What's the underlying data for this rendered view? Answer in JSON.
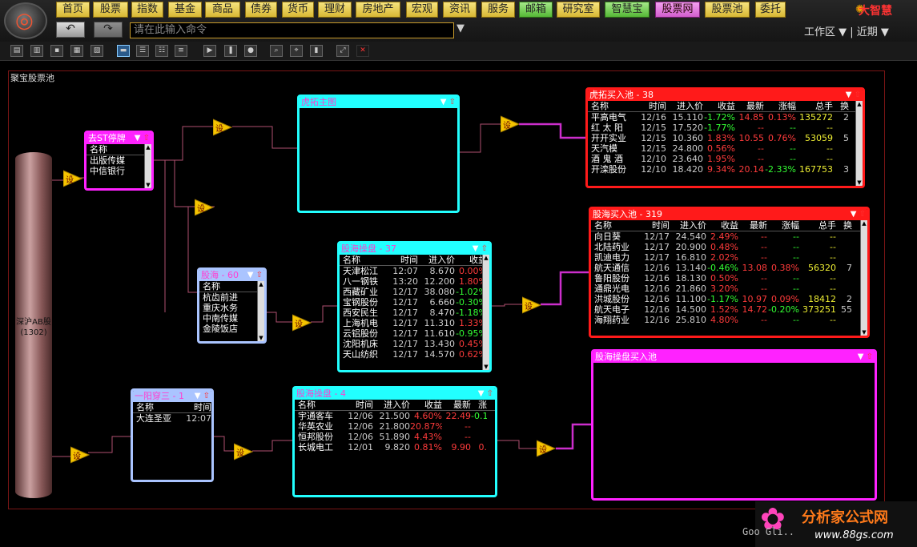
{
  "menu": [
    "首页",
    "股票",
    "指数",
    "基金",
    "商品",
    "债券",
    "货币",
    "理财",
    "房地产",
    "宏观",
    "资讯",
    "服务",
    "邮箱",
    "研究室",
    "智慧宝",
    "股票网",
    "股票池",
    "委托"
  ],
  "brand": "大智慧",
  "command": {
    "placeholder": "请在此输入命令"
  },
  "workzone": "工作区 ▼ | 近期 ▼",
  "board_title": "聚宝股票池",
  "source": {
    "label": "深沪AB股",
    "count": "(1302)"
  },
  "node_label": "设",
  "panels": {
    "quchu": {
      "title": "去ST停牌",
      "head": [
        "名称"
      ],
      "rows": [
        [
          "出版传媒"
        ],
        [
          "中信银行"
        ]
      ]
    },
    "hutuo_zhutu": {
      "title": "虎拓主图"
    },
    "guhai60": {
      "title": "股海 - 60",
      "head": [
        "名称"
      ],
      "rows": [
        [
          "杭齿前进"
        ],
        [
          "重庆水务"
        ],
        [
          "中南传媒"
        ],
        [
          "金陵饭店"
        ]
      ]
    },
    "guhai_caopan": {
      "title": "股海操盘 - 37",
      "head": [
        "名称",
        "时间",
        "进入价",
        "收益"
      ],
      "rows": [
        [
          "天津松江",
          "12:07",
          "8.670",
          "0.00%"
        ],
        [
          "八一钢铁",
          "13:20",
          "12.200",
          "1.80%"
        ],
        [
          "西藏矿业",
          "12/17",
          "38.080",
          "-1.02%"
        ],
        [
          "宝钢股份",
          "12/17",
          "6.660",
          "-0.30%"
        ],
        [
          "西安民生",
          "12/17",
          "8.470",
          "-1.18%"
        ],
        [
          "上海机电",
          "12/17",
          "11.310",
          "1.33%"
        ],
        [
          "云铝股份",
          "12/17",
          "11.610",
          "-0.95%"
        ],
        [
          "沈阳机床",
          "12/17",
          "13.430",
          "0.45%"
        ],
        [
          "天山纺织",
          "12/17",
          "14.570",
          "0.62%"
        ]
      ]
    },
    "yiyang": {
      "title": "一阳穿三 - 1",
      "head": [
        "名称",
        "时间"
      ],
      "rows": [
        [
          "大连圣亚",
          "12:07"
        ]
      ]
    },
    "guhai_caopan4": {
      "title": "股海操盘 - 4",
      "head": [
        "名称",
        "时间",
        "进入价",
        "收益",
        "最新",
        "涨"
      ],
      "rows": [
        [
          "宇通客车",
          "12/06",
          "21.500",
          "4.60%",
          "22.49",
          "-0.1"
        ],
        [
          "华英农业",
          "12/06",
          "21.800",
          "20.87%",
          "--",
          ""
        ],
        [
          "恒邦股份",
          "12/06",
          "51.890",
          "4.43%",
          "--",
          ""
        ],
        [
          "长城电工",
          "12/01",
          "9.820",
          "0.81%",
          "9.90",
          "0."
        ]
      ]
    },
    "hutuo_buy": {
      "title": "虎拓买入池 - 38",
      "head": [
        "名称",
        "时间",
        "进入价",
        "收益",
        "最新",
        "涨幅",
        "总手",
        "换"
      ],
      "rows": [
        [
          "平高电气",
          "12/16",
          "15.110",
          "-1.72%",
          "14.85",
          "0.13%",
          "135272",
          "2"
        ],
        [
          "红 太 阳",
          "12/15",
          "17.520",
          "-1.77%",
          "--",
          "--",
          "--",
          ""
        ],
        [
          "开开实业",
          "12/15",
          "10.360",
          "1.83%",
          "10.55",
          "0.76%",
          "53059",
          "5"
        ],
        [
          "天汽模",
          "12/15",
          "24.800",
          "0.56%",
          "--",
          "--",
          "--",
          ""
        ],
        [
          "酒 鬼 酒",
          "12/10",
          "23.640",
          "1.95%",
          "--",
          "--",
          "--",
          ""
        ],
        [
          "开滦股份",
          "12/10",
          "18.420",
          "9.34%",
          "20.14",
          "-2.33%",
          "167753",
          "3"
        ]
      ]
    },
    "guhai_buy": {
      "title": "股海买入池 - 319",
      "head": [
        "名称",
        "时间",
        "进入价",
        "收益",
        "最新",
        "涨幅",
        "总手",
        "换"
      ],
      "rows": [
        [
          "向日葵",
          "12/17",
          "24.540",
          "2.49%",
          "--",
          "--",
          "--",
          ""
        ],
        [
          "北陆药业",
          "12/17",
          "20.900",
          "0.48%",
          "--",
          "--",
          "--",
          ""
        ],
        [
          "凯迪电力",
          "12/17",
          "16.810",
          "2.02%",
          "--",
          "--",
          "--",
          ""
        ],
        [
          "航天通信",
          "12/16",
          "13.140",
          "-0.46%",
          "13.08",
          "0.38%",
          "56320",
          "7"
        ],
        [
          "鲁阳股份",
          "12/16",
          "18.130",
          "0.50%",
          "--",
          "--",
          "--",
          ""
        ],
        [
          "通鼎光电",
          "12/16",
          "21.860",
          "3.20%",
          "--",
          "--",
          "--",
          ""
        ],
        [
          "洪城股份",
          "12/16",
          "11.100",
          "-1.17%",
          "10.97",
          "0.09%",
          "18412",
          "2"
        ],
        [
          "航天电子",
          "12/16",
          "14.500",
          "1.52%",
          "14.72",
          "-0.20%",
          "373251",
          "55"
        ],
        [
          "海翔药业",
          "12/16",
          "25.810",
          "4.80%",
          "--",
          "--",
          "--",
          ""
        ]
      ]
    },
    "guhai_caopan_buy": {
      "title": "股海操盘买入池"
    }
  },
  "watermark": {
    "site": "分析家公式网",
    "url": "www.88gs.com",
    "note": "Goo Gli.."
  },
  "colors": {
    "magenta": "#ff22ff",
    "cyan": "#22ffff",
    "red": "#ff1a1a",
    "lavender": "#aac4ff",
    "gold": "#f5c400"
  }
}
